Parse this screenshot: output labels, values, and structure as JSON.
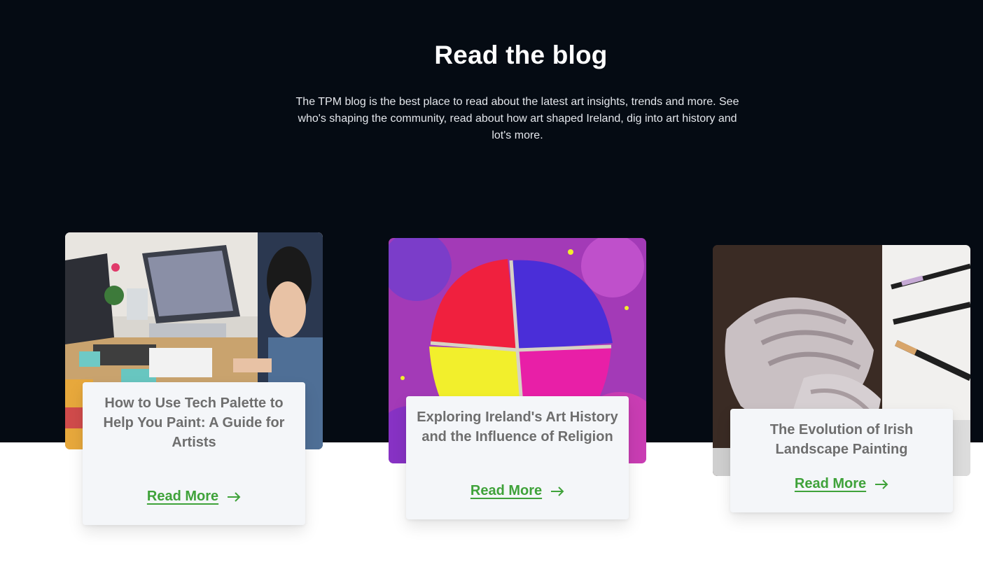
{
  "section": {
    "title": "Read the blog",
    "intro": "The TPM blog is the best place to read about the latest art insights, trends and more. See who's shaping the community, read about how art shaped Ireland, dig into art history and lot's more."
  },
  "posts": [
    {
      "title": "How to Use Tech Palette to Help You Paint: A Guide for Artists",
      "cta": "Read More"
    },
    {
      "title": "Exploring Ireland's Art History and the Influence of Religion",
      "cta": "Read More"
    },
    {
      "title": "The Evolution of Irish Landscape Painting",
      "cta": "Read More"
    }
  ],
  "colors": {
    "background_dark": "#050b13",
    "heading": "#ffffff",
    "card_panel": "#f4f6f9",
    "card_title": "#6e6e6e",
    "cta": "#3fa23a"
  },
  "icons": {
    "cta_icon": "arrow-right-icon"
  }
}
